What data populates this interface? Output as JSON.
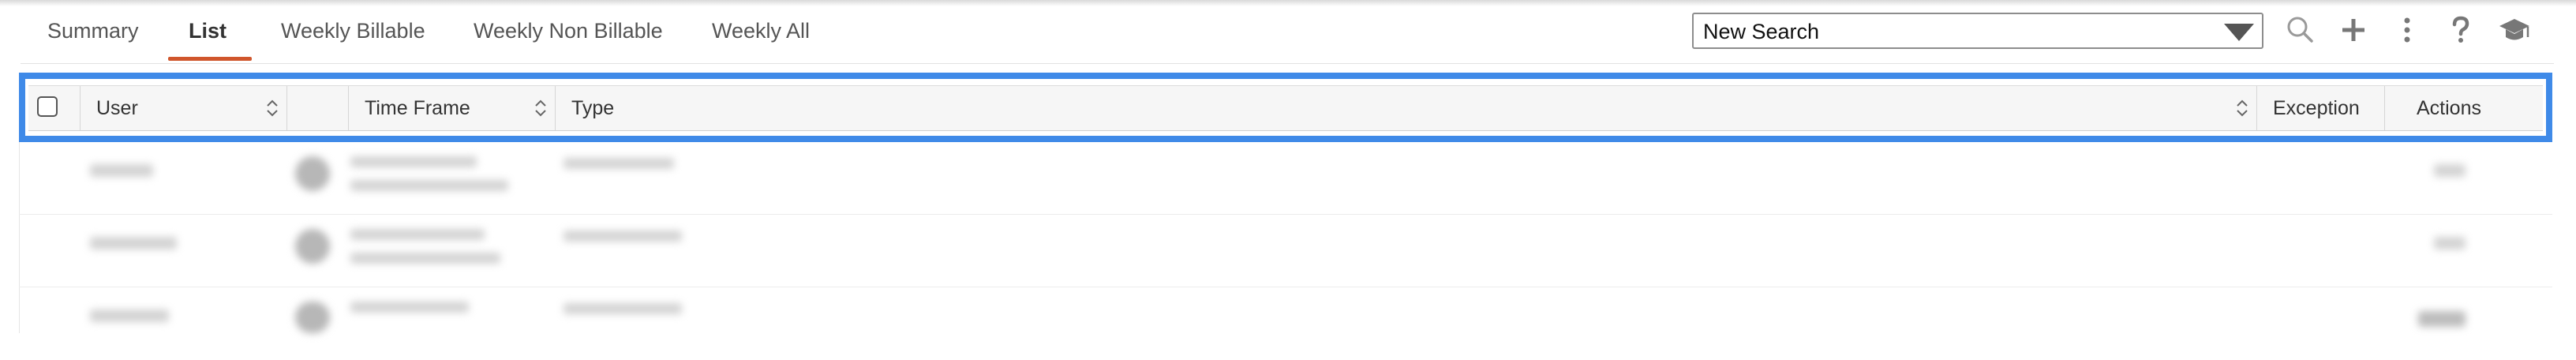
{
  "tabs": {
    "summary": "Summary",
    "list": "List",
    "weekly_billable": "Weekly Billable",
    "weekly_non_billable": "Weekly Non Billable",
    "weekly_all": "Weekly All",
    "active": "List"
  },
  "search": {
    "selected": "New Search"
  },
  "toolbar": {
    "icons": [
      "search-icon",
      "plus-icon",
      "more-vertical-icon",
      "help-icon",
      "graduation-cap-icon"
    ]
  },
  "table": {
    "columns": {
      "user": "User",
      "time_frame": "Time Frame",
      "type": "Type",
      "exception": "Exception",
      "actions": "Actions"
    },
    "select_all_checked": false
  },
  "colors": {
    "accent_underline": "#d0562c",
    "highlight_border": "#3f8ae8"
  }
}
